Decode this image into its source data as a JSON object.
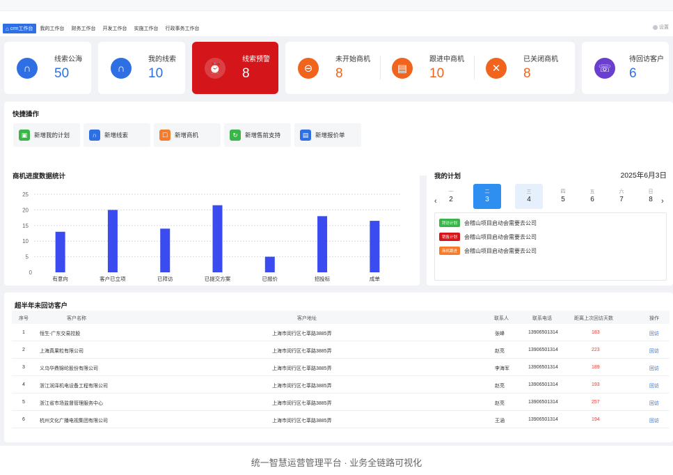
{
  "nav": {
    "tabs": [
      "crm工作台",
      "我的工作台",
      "财务工作台",
      "开发工作台",
      "实施工作台",
      "行政事务工作台"
    ],
    "settings_label": "设置"
  },
  "stats": {
    "leads_pool": {
      "label": "线索公海",
      "value": "50",
      "icon": "pool-icon"
    },
    "my_leads": {
      "label": "我的线索",
      "value": "10",
      "icon": "lead-icon"
    },
    "lead_alert": {
      "label": "线索预警",
      "value": "8",
      "icon": "alarm-icon"
    },
    "not_started": {
      "label": "未开始商机",
      "value": "8",
      "icon": "minus-icon"
    },
    "in_progress": {
      "label": "跟进中商机",
      "value": "10",
      "icon": "doc-icon"
    },
    "closed": {
      "label": "已关闭商机",
      "value": "8",
      "icon": "close-icon"
    },
    "to_visit": {
      "label": "待回访客户",
      "value": "6",
      "icon": "phone-icon"
    }
  },
  "quick": {
    "title": "快捷操作",
    "buttons": [
      {
        "label": "新增我的计划",
        "color": "#3bb54a"
      },
      {
        "label": "新增线索",
        "color": "#2f6fe4"
      },
      {
        "label": "新增商机",
        "color": "#f57c2b"
      },
      {
        "label": "新增售前支持",
        "color": "#3bb54a"
      },
      {
        "label": "新增报价单",
        "color": "#2f6fe4"
      }
    ]
  },
  "chart": {
    "title": "商机进度数据统计"
  },
  "chart_data": {
    "type": "bar",
    "categories": [
      "有意向",
      "客户已立项",
      "已拜访",
      "已提交方案",
      "已报价",
      "招投标",
      "成单"
    ],
    "values": [
      13,
      20,
      14,
      21.5,
      5,
      18,
      16.5
    ],
    "ylim": [
      0,
      25
    ],
    "yticks": [
      0,
      5,
      10,
      15,
      20,
      25
    ],
    "grid": true,
    "color": "#3a4cf0"
  },
  "plan": {
    "title": "我的计划",
    "date": "2025年6月3日",
    "days": [
      {
        "week": "一",
        "num": "2"
      },
      {
        "week": "二",
        "num": "3"
      },
      {
        "week": "三",
        "num": "4"
      },
      {
        "week": "四",
        "num": "5"
      },
      {
        "week": "五",
        "num": "6"
      },
      {
        "week": "六",
        "num": "7"
      },
      {
        "week": "日",
        "num": "8"
      }
    ],
    "items": [
      {
        "tag": "拜访计划",
        "tag_color": "#3bb54a",
        "text": "会稽山项目启动会需要去公司"
      },
      {
        "tag": "销售计划",
        "tag_color": "#d4161b",
        "text": "会稽山项目启动会需要去公司"
      },
      {
        "tag": "商机跟进",
        "tag_color": "#f57c2b",
        "text": "会稽山项目启动会需要去公司"
      }
    ]
  },
  "table": {
    "title": "超半年未回访客户",
    "headers": [
      "序号",
      "客户名称",
      "客户地址",
      "联系人",
      "联系电话",
      "距离上次回访天数",
      "操作"
    ],
    "rows": [
      [
        "1",
        "恒生-广东交易控股",
        "上海市闵行区七莘路3885弄",
        "张峰",
        "13906501314",
        "183",
        "回访"
      ],
      [
        "2",
        "上海真果粒有限公司",
        "上海市闵行区七莘路3885弄",
        "赵亮",
        "13906501314",
        "223",
        "回访"
      ],
      [
        "3",
        "义乌华鼎锦纶股份有限公司",
        "上海市闵行区七莘路3885弄",
        "李海军",
        "13906501314",
        "189",
        "回访"
      ],
      [
        "4",
        "浙江润泽机电设备工程有限公司",
        "上海市闵行区七莘路3885弄",
        "赵亮",
        "13906501314",
        "193",
        "回访"
      ],
      [
        "5",
        "浙江省市场监督管理服务中心",
        "上海市闵行区七莘路3885弄",
        "赵亮",
        "13906501314",
        "257",
        "回访"
      ],
      [
        "6",
        "杭州文化广播电视集团有限公司",
        "上海市闵行区七莘路3885弄",
        "王涵",
        "13906501314",
        "194",
        "回访"
      ]
    ]
  },
  "caption": "统一智慧运营管理平台 · 业务全链路可视化"
}
